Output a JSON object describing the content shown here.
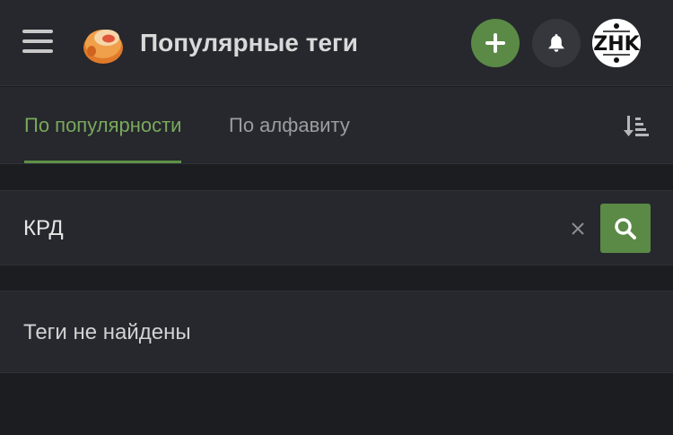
{
  "header": {
    "title": "Популярные теги",
    "menu_icon": "hamburger-menu-icon",
    "logo_icon": "app-logo-icon",
    "add_icon": "plus-icon",
    "bell_icon": "bell-icon",
    "avatar_label": "ZHK"
  },
  "tabs": [
    {
      "label": "По популярности",
      "active": true
    },
    {
      "label": "По алфавиту",
      "active": false
    }
  ],
  "sort_icon": "sort-descending-icon",
  "search": {
    "value": "КРД",
    "clear_icon": "close-icon",
    "button_icon": "search-icon"
  },
  "results": {
    "empty_message": "Теги не найдены"
  },
  "colors": {
    "accent": "#5a8a46",
    "accent_text": "#7aa85c",
    "background": "#1b1d21",
    "panel": "#26282d"
  }
}
